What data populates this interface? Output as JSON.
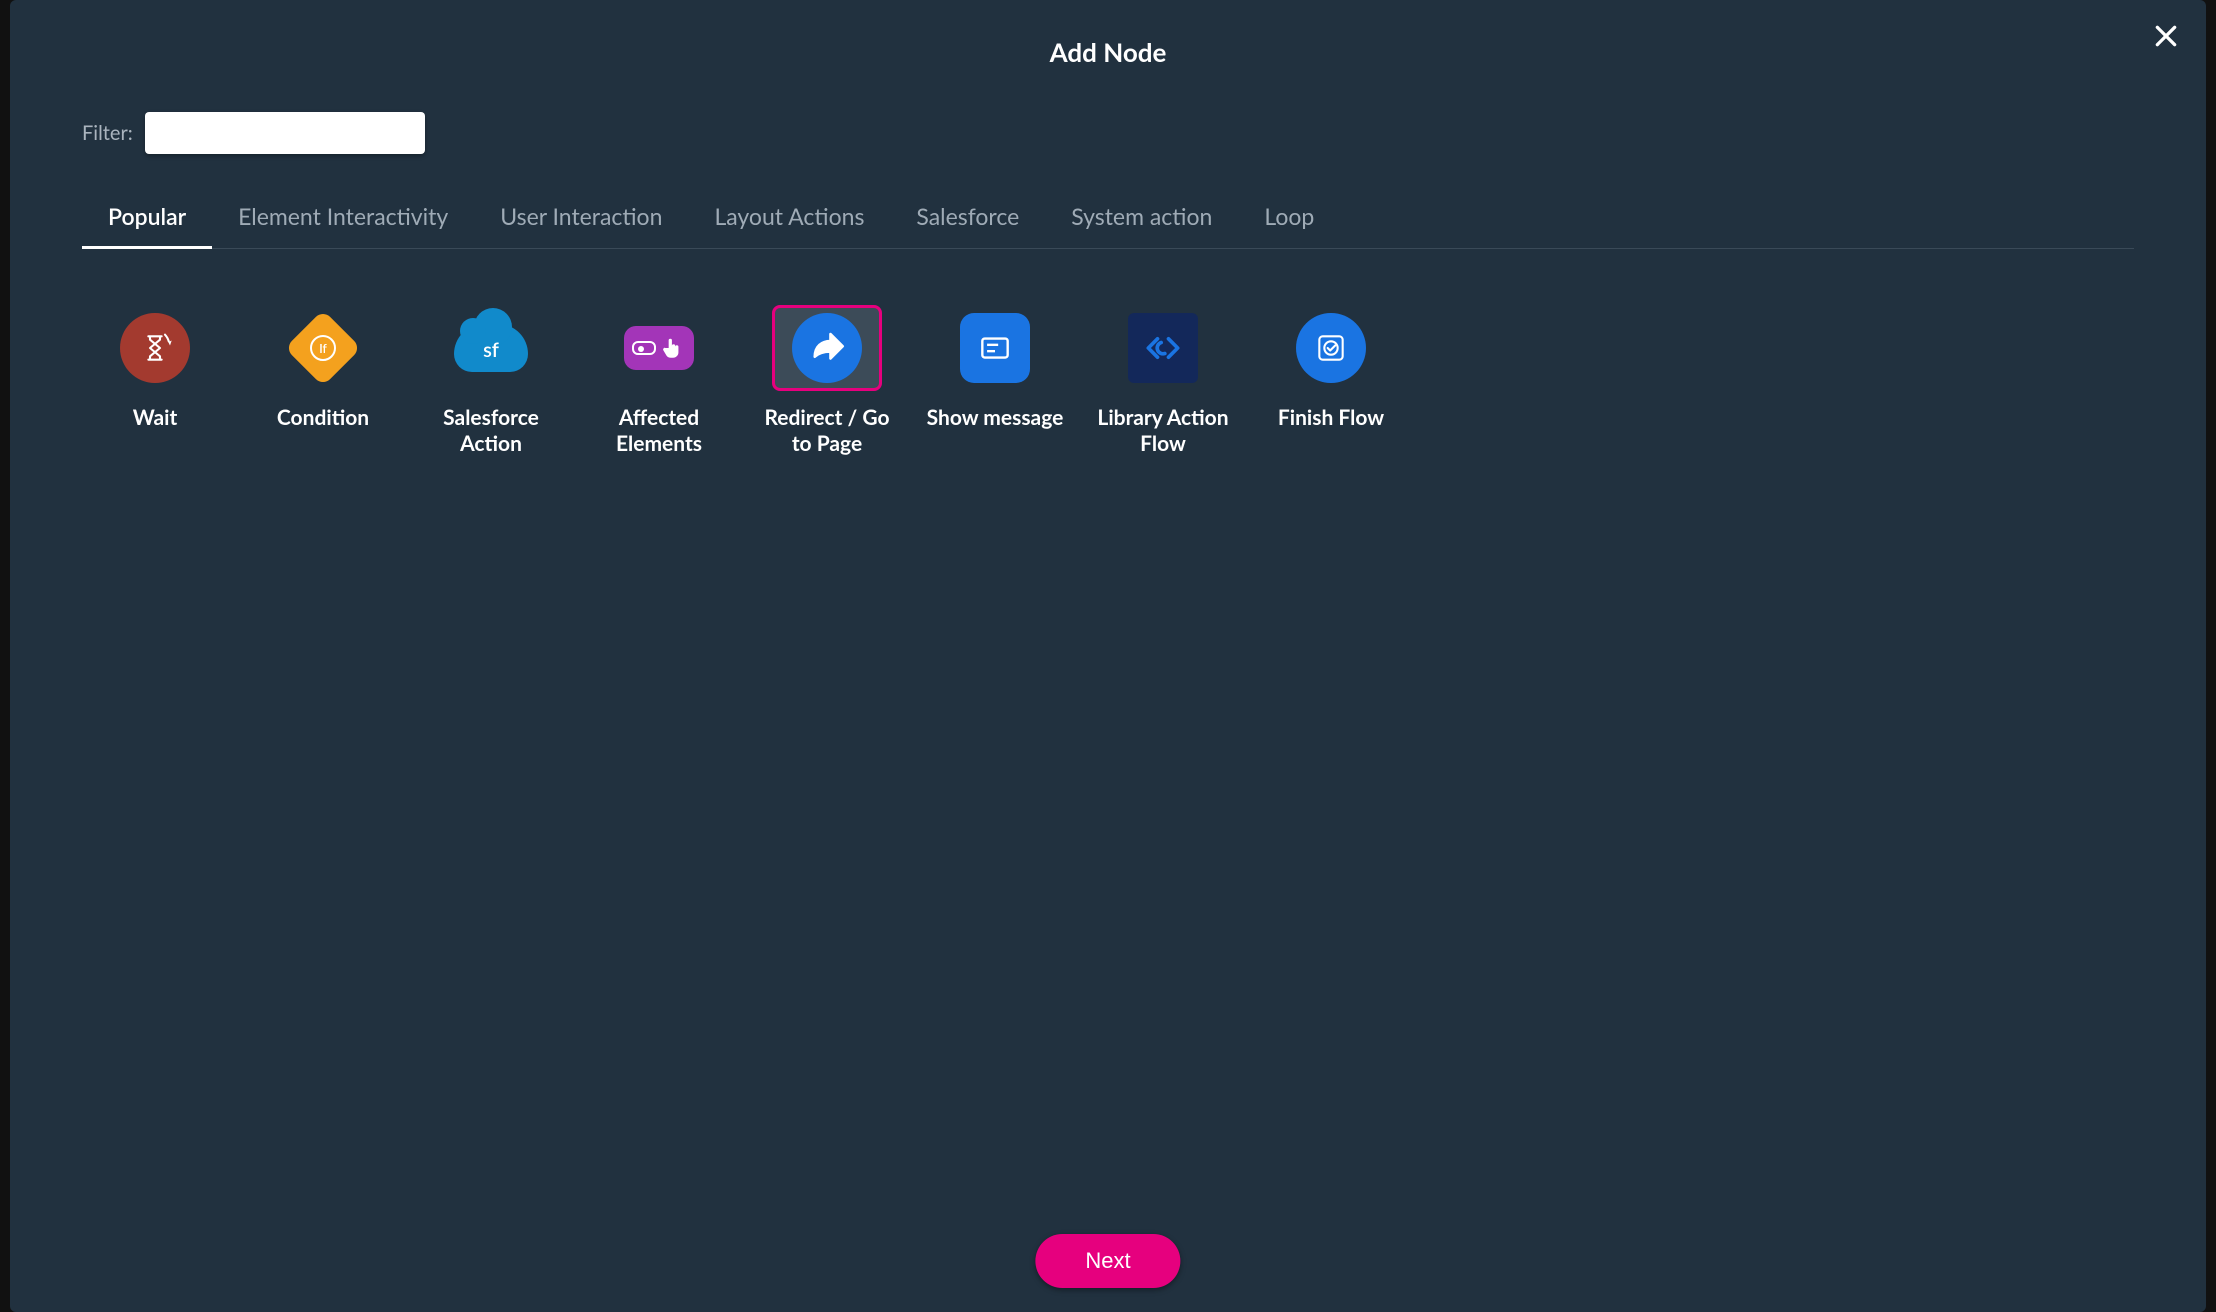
{
  "modal": {
    "title": "Add Node",
    "filter_label": "Filter:",
    "filter_value": "",
    "next_label": "Next"
  },
  "tabs": [
    {
      "label": "Popular",
      "active": true
    },
    {
      "label": "Element Interactivity",
      "active": false
    },
    {
      "label": "User Interaction",
      "active": false
    },
    {
      "label": "Layout Actions",
      "active": false
    },
    {
      "label": "Salesforce",
      "active": false
    },
    {
      "label": "System action",
      "active": false
    },
    {
      "label": "Loop",
      "active": false
    }
  ],
  "nodes": [
    {
      "id": "wait",
      "label": "Wait",
      "icon": "hourglass-icon",
      "selected": false
    },
    {
      "id": "condition",
      "label": "Condition",
      "icon": "condition-diamond-icon",
      "selected": false
    },
    {
      "id": "salesforce-action",
      "label": "Salesforce Action",
      "icon": "cloud-sf-icon",
      "selected": false
    },
    {
      "id": "affected-elements",
      "label": "Affected Elements",
      "icon": "hand-button-icon",
      "selected": false
    },
    {
      "id": "redirect",
      "label": "Redirect / Go to Page",
      "icon": "arrow-redirect-icon",
      "selected": true
    },
    {
      "id": "show-message",
      "label": "Show message",
      "icon": "message-icon",
      "selected": false
    },
    {
      "id": "library-action-flow",
      "label": "Library Action Flow",
      "icon": "code-brackets-icon",
      "selected": false
    },
    {
      "id": "finish-flow",
      "label": "Finish Flow",
      "icon": "checkmark-circle-icon",
      "selected": false
    }
  ]
}
